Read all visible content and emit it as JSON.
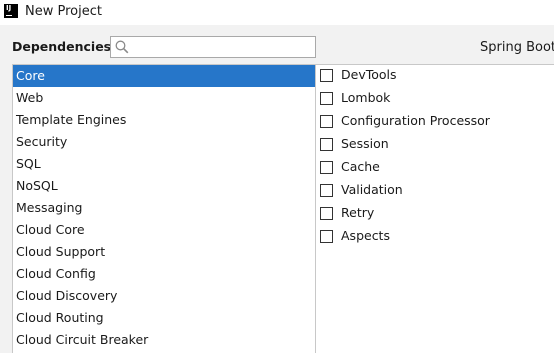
{
  "window": {
    "title": "New Project"
  },
  "header": {
    "dependencies_label": "Dependencies",
    "search": {
      "value": "",
      "placeholder": ""
    },
    "spring_boot_label": "Spring Boot"
  },
  "categories": [
    {
      "label": "Core",
      "selected": true
    },
    {
      "label": "Web"
    },
    {
      "label": "Template Engines"
    },
    {
      "label": "Security"
    },
    {
      "label": "SQL"
    },
    {
      "label": "NoSQL"
    },
    {
      "label": "Messaging"
    },
    {
      "label": "Cloud Core"
    },
    {
      "label": "Cloud Support"
    },
    {
      "label": "Cloud Config"
    },
    {
      "label": "Cloud Discovery"
    },
    {
      "label": "Cloud Routing"
    },
    {
      "label": "Cloud Circuit Breaker"
    }
  ],
  "dependencies": [
    {
      "label": "DevTools",
      "checked": false
    },
    {
      "label": "Lombok",
      "checked": false
    },
    {
      "label": "Configuration Processor",
      "checked": false
    },
    {
      "label": "Session",
      "checked": false
    },
    {
      "label": "Cache",
      "checked": false
    },
    {
      "label": "Validation",
      "checked": false
    },
    {
      "label": "Retry",
      "checked": false
    },
    {
      "label": "Aspects",
      "checked": false
    }
  ],
  "colors": {
    "selection": "#2676c9",
    "background": "#f2f2f2"
  }
}
